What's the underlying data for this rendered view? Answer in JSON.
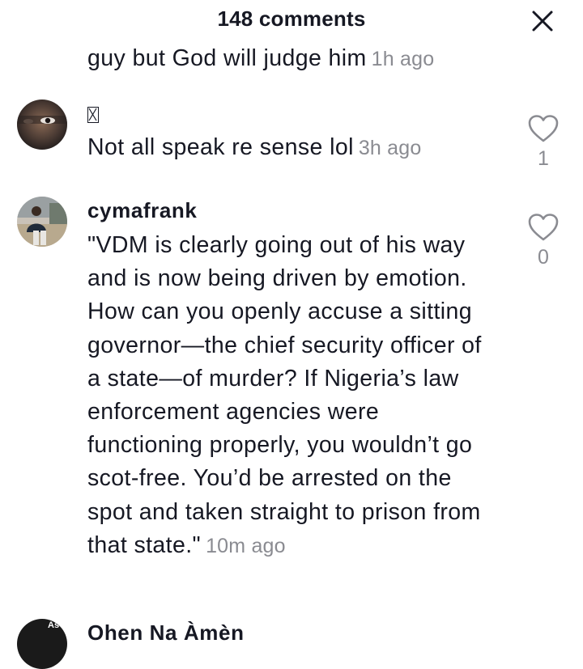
{
  "header": {
    "title": "148 comments",
    "close_icon": "close-icon"
  },
  "comments": [
    {
      "text": "guy but God will judge him",
      "time": "1h ago"
    },
    {
      "username": "",
      "username_glyph": "missing-glyph-icon",
      "text": "Not all speak re sense lol",
      "time": "3h ago",
      "likes": "1"
    },
    {
      "username": "cymafrank",
      "text": "\"VDM is clearly going out of his way and is now being driven by emotion. How can you openly accuse a sitting governor—the chief security officer of a state—of murder? If Nigeria’s law enforcement agencies were functioning properly, you wouldn’t go scot-free. You’d be arrested on the spot and taken straight to prison from that state.\"",
      "time": "10m ago",
      "likes": "0"
    },
    {
      "username": "Ohen Na Àmèn",
      "avatar_text": "As"
    }
  ],
  "colors": {
    "text": "#161823",
    "secondary": "#8a8b91",
    "background": "#ffffff"
  }
}
